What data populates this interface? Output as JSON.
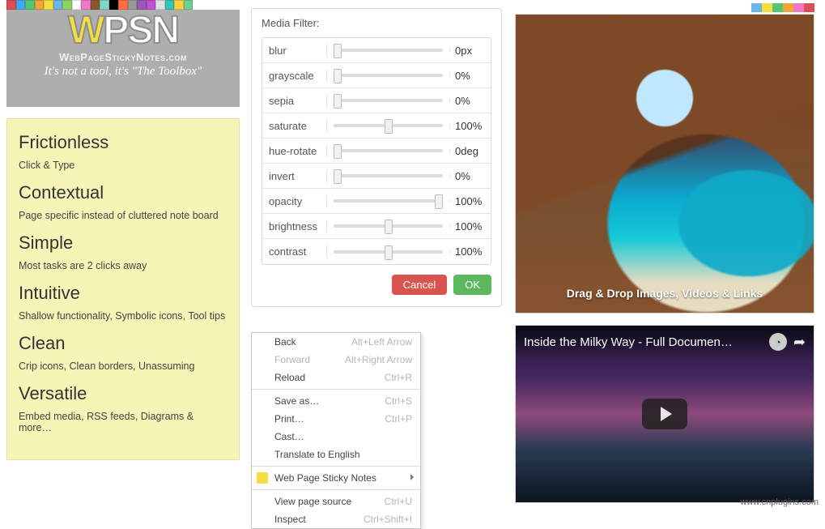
{
  "logo": {
    "title_text": "WPSN",
    "domain": "WebPageStickyNotes.com",
    "tagline": "It's not a tool, it's \"The Toolbox\""
  },
  "note": {
    "sections": [
      {
        "title": "Frictionless",
        "desc": "Click & Type"
      },
      {
        "title": "Contextual",
        "desc": "Page specific instead of cluttered note board"
      },
      {
        "title": "Simple",
        "desc": "Most tasks are 2 clicks away"
      },
      {
        "title": "Intuitive",
        "desc": "Shallow functionality, Symbolic icons, Tool tips"
      },
      {
        "title": "Clean",
        "desc": "Crip icons, Clean borders, Unassuming"
      },
      {
        "title": "Versatile",
        "desc": "Embed media, RSS feeds, Diagrams & more…"
      }
    ]
  },
  "media_filter": {
    "title": "Media Filter:",
    "rows": [
      {
        "name": "blur",
        "value": "0px",
        "pos": 4
      },
      {
        "name": "grayscale",
        "value": "0%",
        "pos": 4
      },
      {
        "name": "sepia",
        "value": "0%",
        "pos": 4
      },
      {
        "name": "saturate",
        "value": "100%",
        "pos": 50
      },
      {
        "name": "hue-rotate",
        "value": "0deg",
        "pos": 4
      },
      {
        "name": "invert",
        "value": "0%",
        "pos": 4
      },
      {
        "name": "opacity",
        "value": "100%",
        "pos": 96
      },
      {
        "name": "brightness",
        "value": "100%",
        "pos": 50
      },
      {
        "name": "contrast",
        "value": "100%",
        "pos": 50
      }
    ],
    "cancel_label": "Cancel",
    "ok_label": "OK"
  },
  "context_menu": {
    "items": [
      {
        "label": "Back",
        "shortcut": "Alt+Left Arrow",
        "disabled": false
      },
      {
        "label": "Forward",
        "shortcut": "Alt+Right Arrow",
        "disabled": true
      },
      {
        "label": "Reload",
        "shortcut": "Ctrl+R"
      },
      {
        "sep": true
      },
      {
        "label": "Save as…",
        "shortcut": "Ctrl+S"
      },
      {
        "label": "Print…",
        "shortcut": "Ctrl+P"
      },
      {
        "label": "Cast…"
      },
      {
        "label": "Translate to English"
      },
      {
        "sep": true
      },
      {
        "label": "Web Page Sticky Notes",
        "icon": true,
        "submenu": true
      },
      {
        "sep": true
      },
      {
        "label": "View page source",
        "shortcut": "Ctrl+U"
      },
      {
        "label": "Inspect",
        "shortcut": "Ctrl+Shift+I"
      }
    ]
  },
  "image_note": {
    "overlay": "Drag & Drop Images, Videos & Links"
  },
  "video_note": {
    "title": "Inside the Milky Way - Full Documen…"
  },
  "watermark": "www.cnplugins.com",
  "toolbar_colors": [
    "#d94f55",
    "#3fa9f5",
    "#54c571",
    "#f2a33a",
    "#f4df3f",
    "#6bb6e8",
    "#8dd35f",
    "#ffffff",
    "#f177c8",
    "#8b572a",
    "#7ed6c6",
    "#000000",
    "#ff6f3c",
    "#999999",
    "#9b59b6",
    "#c34fd1",
    "#e0e0e0",
    "#31c6b8",
    "#ffcf3f",
    "#6fcf97"
  ],
  "mini_toolbar_colors": [
    "#6bb6e8",
    "#f4df3f",
    "#54c571",
    "#f2a33a",
    "#f177c8",
    "#d94f55"
  ]
}
